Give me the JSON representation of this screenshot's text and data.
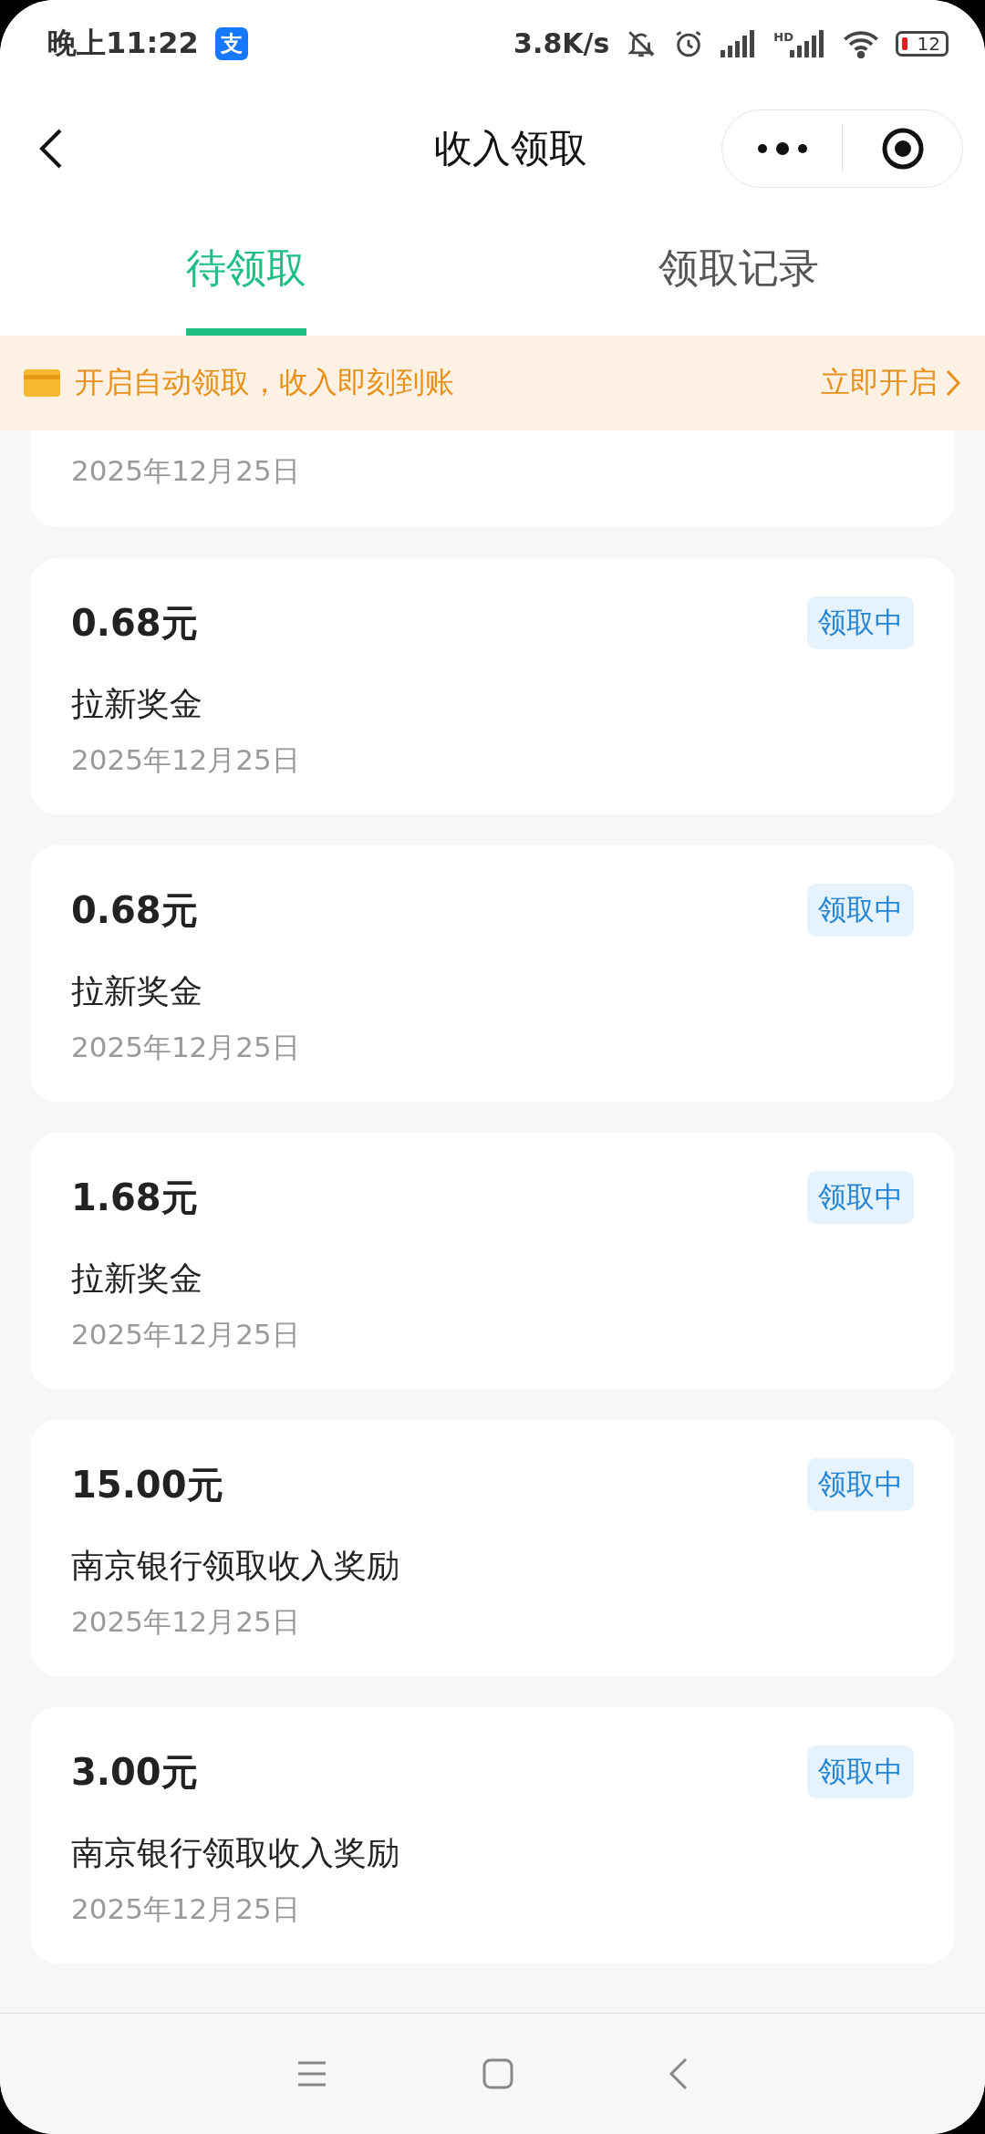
{
  "status_bar": {
    "time": "晚上11:22",
    "app_badge": "支",
    "speed": "3.8K/s",
    "network_label": "HD",
    "battery": "12"
  },
  "header": {
    "title": "收入领取"
  },
  "tabs": [
    {
      "label": "待领取",
      "selected": true
    },
    {
      "label": "领取记录",
      "selected": false
    }
  ],
  "banner": {
    "text": "开启自动领取，收入即刻到账",
    "action": "立即开启"
  },
  "records": [
    {
      "kind": "partial",
      "date": "2025年12月25日"
    },
    {
      "kind": "full",
      "amount": "0.68元",
      "status": "领取中",
      "name": "拉新奖金",
      "date": "2025年12月25日"
    },
    {
      "kind": "full",
      "amount": "0.68元",
      "status": "领取中",
      "name": "拉新奖金",
      "date": "2025年12月25日"
    },
    {
      "kind": "full",
      "amount": "1.68元",
      "status": "领取中",
      "name": "拉新奖金",
      "date": "2025年12月25日"
    },
    {
      "kind": "full",
      "amount": "15.00元",
      "status": "领取中",
      "name": "南京银行领取收入奖励",
      "date": "2025年12月25日"
    },
    {
      "kind": "full",
      "amount": "3.00元",
      "status": "领取中",
      "name": "南京银行领取收入奖励",
      "date": "2025年12月25日"
    }
  ]
}
